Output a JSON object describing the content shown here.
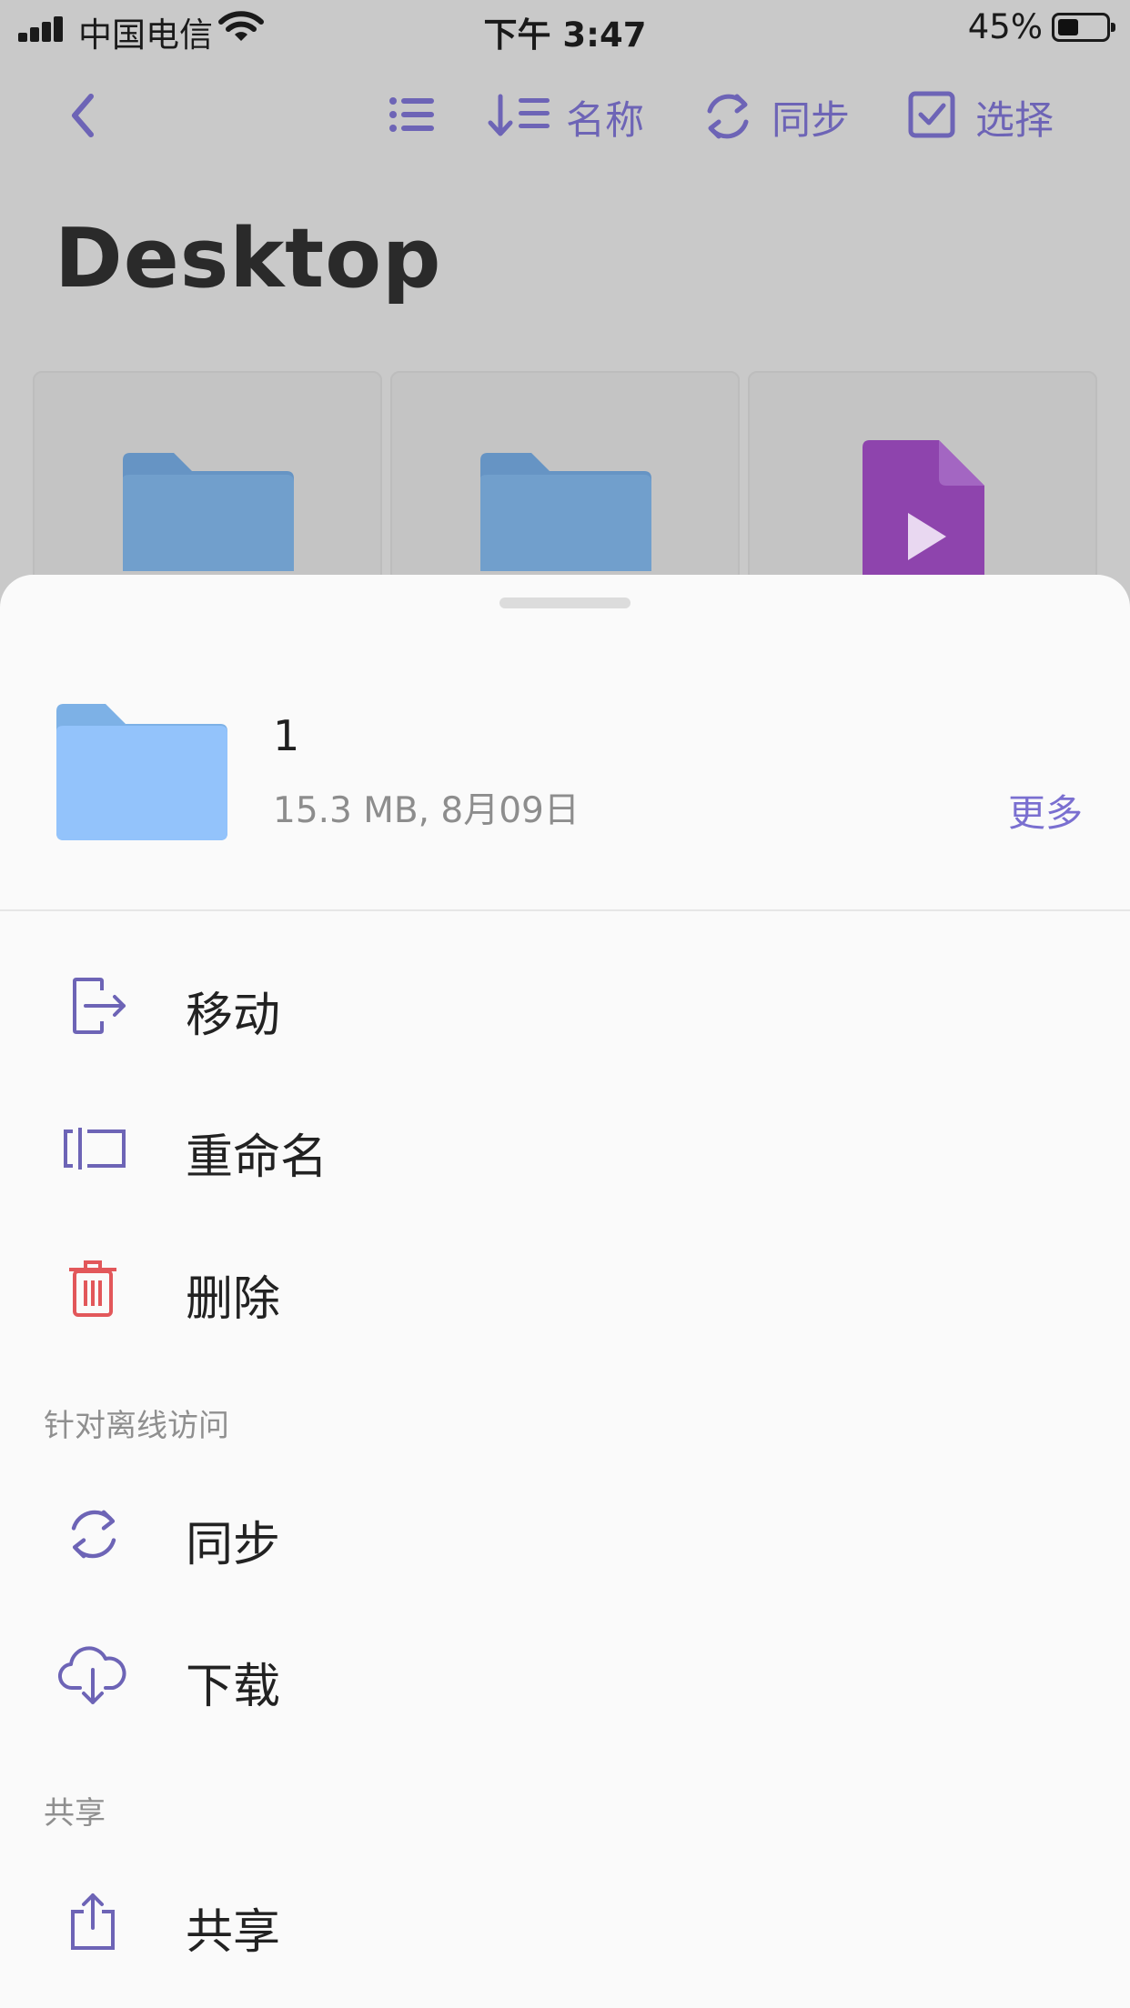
{
  "status_bar": {
    "carrier": "中国电信",
    "time": "下午 3:47",
    "battery_percent": "45%"
  },
  "toolbar": {
    "sort_label": "名称",
    "sync_label": "同步",
    "select_label": "选择"
  },
  "page": {
    "title": "Desktop"
  },
  "sheet": {
    "item": {
      "name": "1",
      "meta": "15.3 MB, 8月09日",
      "more_label": "更多"
    },
    "actions": {
      "move": "移动",
      "rename": "重命名",
      "delete": "删除"
    },
    "offline_section": {
      "header": "针对离线访问",
      "sync": "同步",
      "download": "下载"
    },
    "share_section": {
      "header": "共享",
      "share": "共享"
    }
  },
  "colors": {
    "accent": "#6d64b6",
    "folder_blue": "#93c3fb",
    "danger": "#e2575a",
    "video_purple": "#8e44ad"
  }
}
